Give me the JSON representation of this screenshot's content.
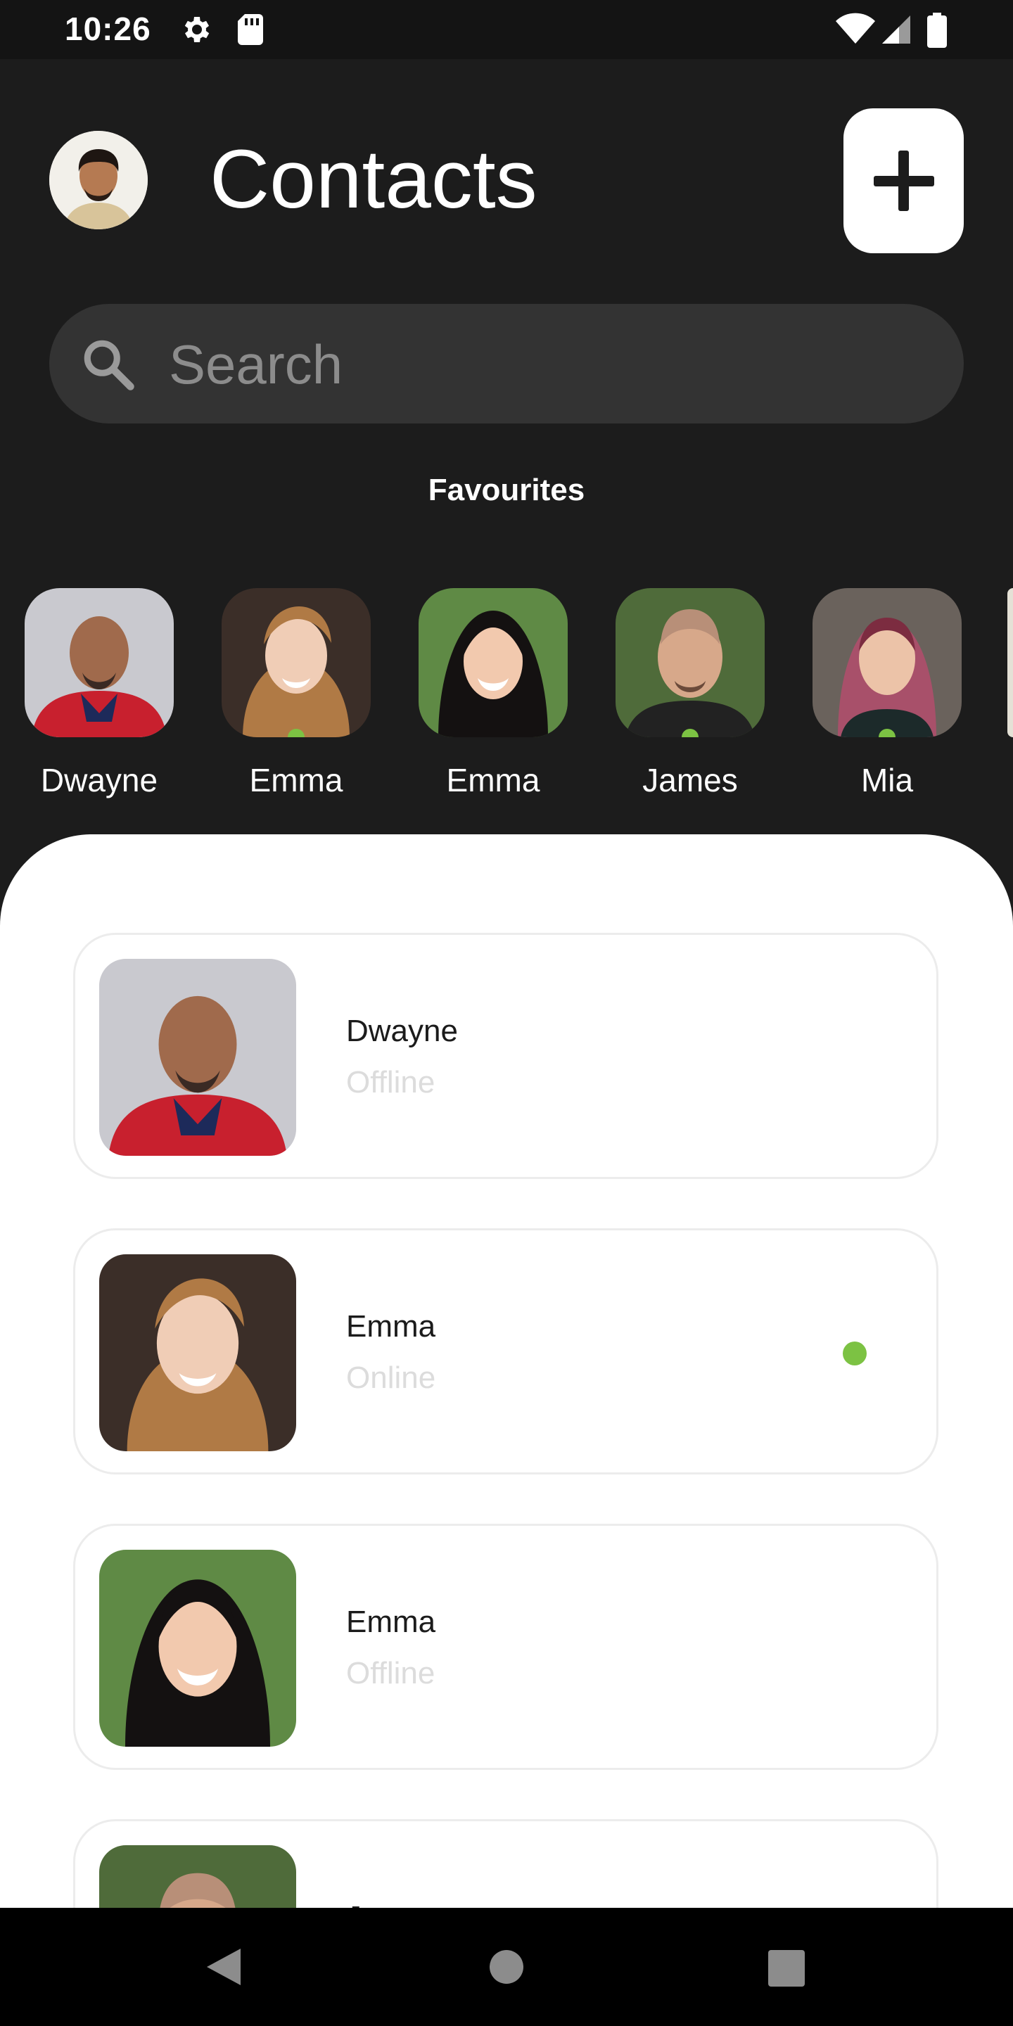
{
  "status_bar": {
    "time": "10:26"
  },
  "header": {
    "title": "Contacts"
  },
  "search": {
    "placeholder": "Search"
  },
  "favourites": {
    "title": "Favourites",
    "items": [
      {
        "name": "Dwayne",
        "online": false
      },
      {
        "name": "Emma",
        "online": true
      },
      {
        "name": "Emma",
        "online": false
      },
      {
        "name": "James",
        "online": true
      },
      {
        "name": "Mia",
        "online": true
      }
    ]
  },
  "contacts": [
    {
      "name": "Dwayne",
      "status": "Offline",
      "online": false
    },
    {
      "name": "Emma",
      "status": "Online",
      "online": true
    },
    {
      "name": "Emma",
      "status": "Offline",
      "online": false
    },
    {
      "name": "James",
      "status": "",
      "online": false
    }
  ],
  "colors": {
    "background": "#1c1c1c",
    "accent_online": "#7cc243",
    "card_border": "#ececec"
  },
  "icons": [
    "settings-icon",
    "sd-card-icon",
    "wifi-icon",
    "signal-icon",
    "battery-icon",
    "search-icon",
    "plus-icon",
    "back-icon",
    "home-icon",
    "recents-icon"
  ]
}
